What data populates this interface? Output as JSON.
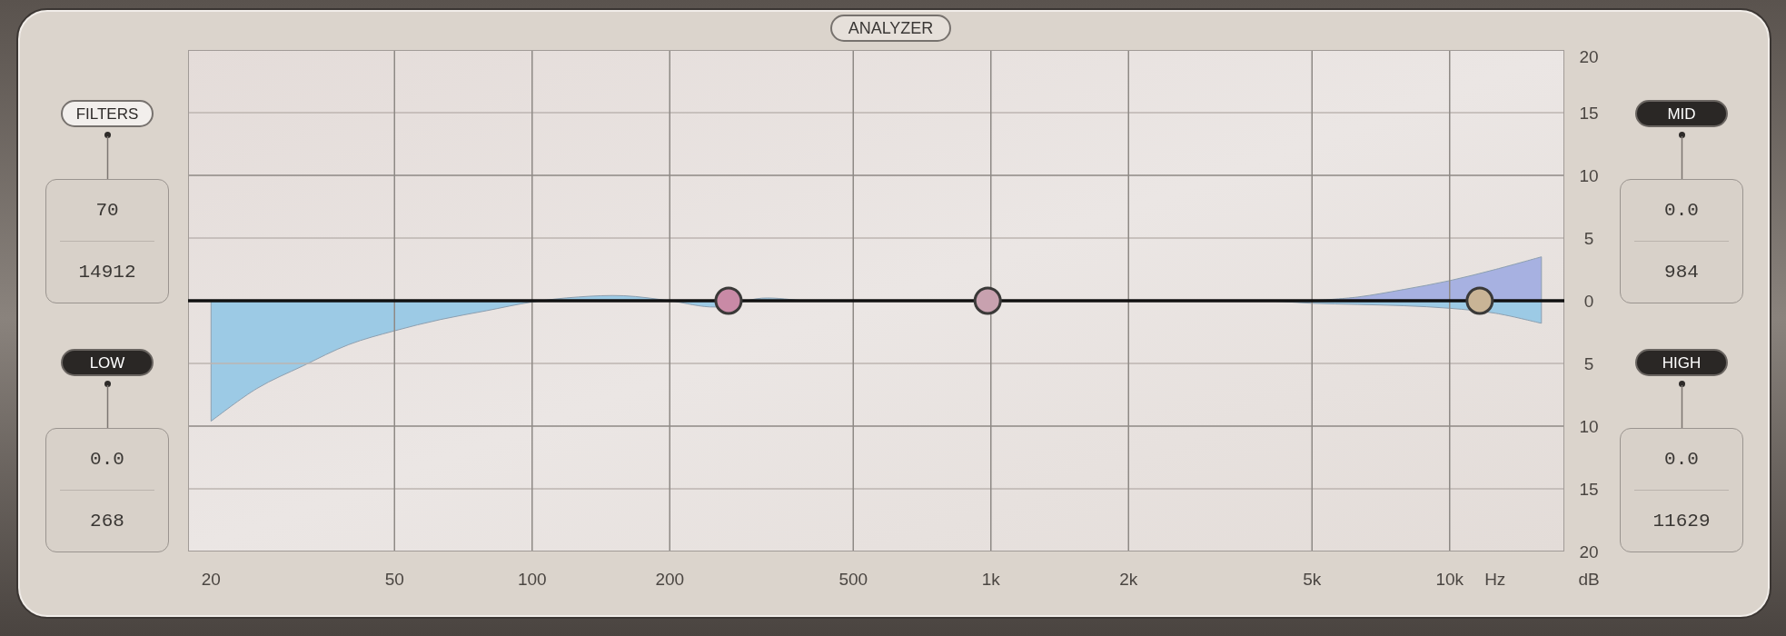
{
  "analyzer": {
    "label": "ANALYZER",
    "on": false
  },
  "left_bands": [
    {
      "label": "FILTERS",
      "on": false,
      "values": [
        "70",
        "14912"
      ]
    },
    {
      "label": "LOW",
      "on": true,
      "values": [
        "0.0",
        "268"
      ],
      "color": "#c98aa6"
    }
  ],
  "right_bands": [
    {
      "label": "MID",
      "on": true,
      "values": [
        "0.0",
        "984"
      ],
      "color": "#c8a1af"
    },
    {
      "label": "HIGH",
      "on": true,
      "values": [
        "0.0",
        "11629"
      ],
      "color": "#c9b496"
    }
  ],
  "eq_graph": {
    "chart_data": {
      "type": "area",
      "xlabel": "Hz",
      "ylabel": "dB",
      "grid": true,
      "categories": [
        "20",
        null,
        null,
        null,
        "50",
        null,
        null,
        "100",
        null,
        null,
        "200",
        null,
        null,
        null,
        "500",
        null,
        null,
        "1k",
        null,
        null,
        "2k",
        null,
        null,
        null,
        "5k",
        null,
        null,
        "10k",
        null,
        null
      ],
      "series": [
        {
          "color": "#9ccae5",
          "values": [
            -9.6,
            -7,
            -5.2,
            -3.5,
            -2.4,
            -1.5,
            -0.8,
            -0.1,
            0.3,
            0.4,
            0,
            -0.5,
            0.2,
            0,
            0,
            0,
            0,
            null,
            0,
            0,
            0,
            0,
            0,
            0,
            -0.2,
            -0.3,
            -0.4,
            -0.6,
            -1.0,
            -1.8
          ]
        },
        {
          "color": "#a7b1e1",
          "values": [
            null,
            null,
            null,
            null,
            null,
            null,
            null,
            null,
            null,
            null,
            null,
            null,
            null,
            null,
            null,
            null,
            null,
            null,
            null,
            null,
            null,
            null,
            null,
            null,
            0,
            0.3,
            0.9,
            1.6,
            2.5,
            3.5
          ]
        }
      ],
      "ylim": [
        -20,
        20
      ],
      "yticks": [
        {
          "value": -20,
          "label": "20"
        },
        {
          "value": -15,
          "label": "15"
        },
        {
          "value": -10,
          "label": "10"
        },
        {
          "value": -5,
          "label": "5"
        },
        {
          "value": 0,
          "label": "0"
        },
        {
          "value": 5,
          "label": "5"
        },
        {
          "value": 10,
          "label": "10"
        },
        {
          "value": 15,
          "label": "15"
        },
        {
          "value": 20,
          "label": "20"
        }
      ]
    }
  }
}
